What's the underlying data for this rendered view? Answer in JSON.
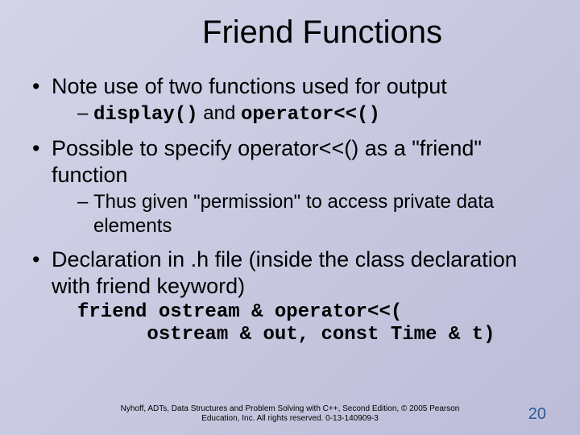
{
  "title": "Friend Functions",
  "bullets": {
    "b1": "Note use of two functions used for output",
    "b1_sub_code1": "display()",
    "b1_sub_mid": " and ",
    "b1_sub_code2": "operator<<()",
    "b2": "Possible to specify operator<<() as a \"friend\" function",
    "b2_sub": "Thus given \"permission\" to access private data elements",
    "b3": "Declaration in .h file (inside the class declaration with friend keyword)",
    "code_line1": "friend ostream & operator<<(",
    "code_line2": "      ostream & out, const Time & t)"
  },
  "footer": {
    "line1": "Nyhoff, ADTs, Data Structures and Problem Solving with C++, Second Edition, © 2005 Pearson",
    "line2": "Education, Inc. All rights reserved. 0-13-140909-3"
  },
  "page_number": "20"
}
